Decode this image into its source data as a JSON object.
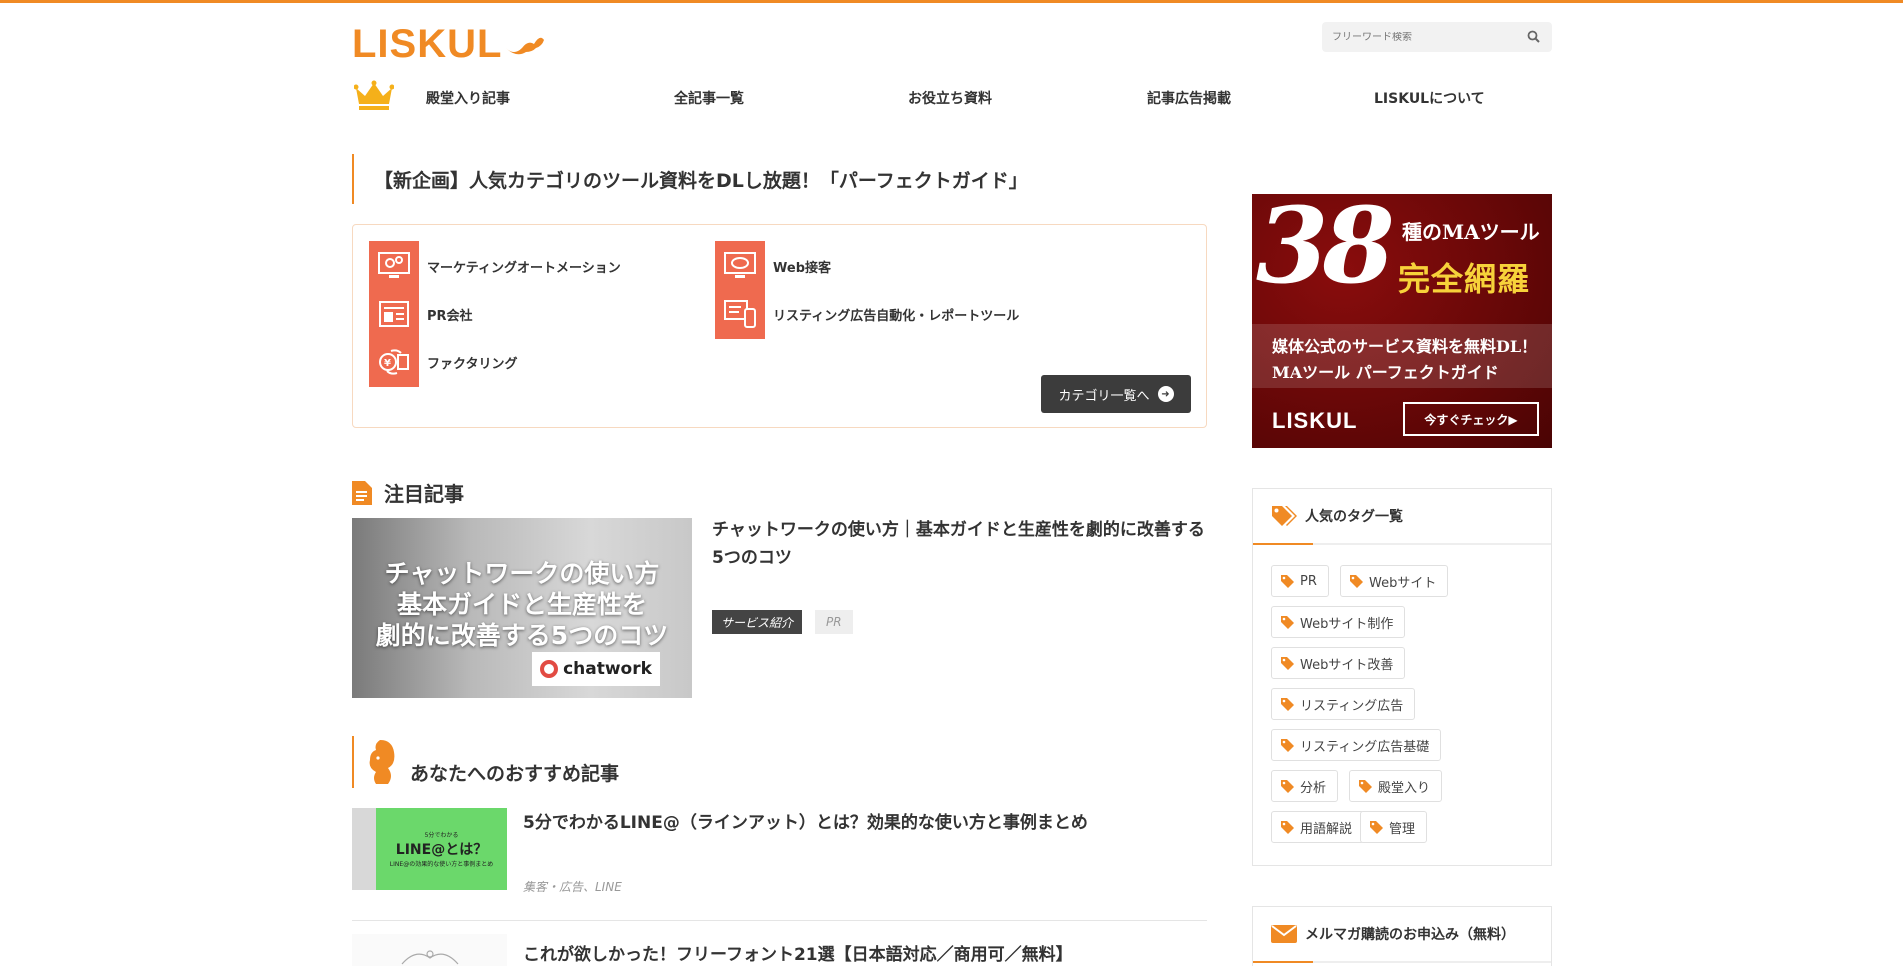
{
  "header": {
    "logo_text": "LISKUL",
    "search_placeholder": "フリーワード検索"
  },
  "nav": {
    "items": [
      {
        "label": "殿堂入り記事"
      },
      {
        "label": "全記事一覧"
      },
      {
        "label": "お役立ち資料"
      },
      {
        "label": "記事広告掲載"
      },
      {
        "label": "LISKULについて"
      }
    ]
  },
  "promo": {
    "title": "【新企画】人気カテゴリのツール資料をDLし放題！「パーフェクトガイド」",
    "categories": [
      {
        "label": "マーケティングオートメーション"
      },
      {
        "label": "Web接客"
      },
      {
        "label": "PR会社"
      },
      {
        "label": "リスティング広告自動化・レポートツール"
      },
      {
        "label": "ファクタリング"
      }
    ],
    "button_label": "カテゴリ一覧へ"
  },
  "featured": {
    "heading": "注目記事",
    "image_text_lines": [
      "チャットワークの使い方",
      "基本ガイドと生産性を",
      "劇的に改善する5つのコツ"
    ],
    "image_logo": "chatwork",
    "title": "チャットワークの使い方｜基本ガイドと生産性を劇的に改善する5つのコツ",
    "tag_primary": "サービス紹介",
    "tag_secondary": "PR"
  },
  "recommended": {
    "heading": "あなたへのおすすめ記事",
    "items": [
      {
        "image_small": "5分でわかる",
        "image_big": "LINE@とは？",
        "image_caption": "LINE@の効果的な使い方と事例まとめ",
        "title": "5分でわかるLINE@（ラインアット）とは？効果的な使い方と事例まとめ",
        "tags": "集客・広告、LINE"
      },
      {
        "title": "これが欲しかった！フリーフォント21選【日本語対応／商用可／無料】"
      }
    ]
  },
  "sidebar": {
    "banner": {
      "number": "38",
      "sub": "種のMAツール",
      "big": "完全網羅",
      "line1": "媒体公式のサービス資料を無料DL！",
      "line2": "MAツール パーフェクトガイド",
      "logo": "LISKUL",
      "button": "今すぐチェック▶"
    },
    "tags_heading": "人気のタグ一覧",
    "tags": [
      {
        "label": "PR"
      },
      {
        "label": "Webサイト"
      },
      {
        "label": "Webサイト制作"
      },
      {
        "label": "Webサイト改善"
      },
      {
        "label": "リスティング広告"
      },
      {
        "label": "リスティング広告基礎"
      },
      {
        "label": "分析"
      },
      {
        "label": "殿堂入り"
      },
      {
        "label": "用語解説"
      },
      {
        "label": "管理"
      }
    ],
    "newsletter_heading": "メルマガ購読のお申込み（無料）"
  },
  "colors": {
    "accent": "#f08a24",
    "category_icon": "#ef6a4f",
    "banner_bg": "#6b0808",
    "banner_gold": "#f7d23a"
  },
  "icons": {
    "search": "search-icon",
    "crown": "crown-icon",
    "document": "document-icon",
    "squirrel": "squirrel-icon",
    "tag": "tag-icon",
    "mail": "mail-icon"
  }
}
